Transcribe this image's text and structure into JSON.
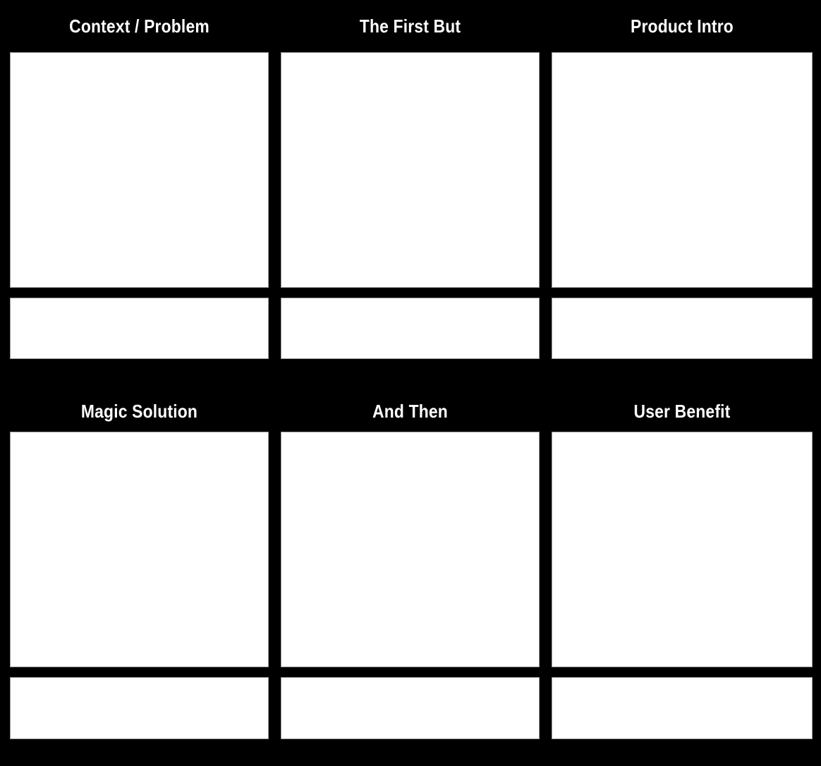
{
  "board": {
    "background_color": "#000000",
    "panel_fill_color": "#ffffff",
    "panel_border_color": "#9a9a9a",
    "title_color": "#ffffff",
    "rows": [
      {
        "panels": [
          {
            "title": "Context / Problem",
            "image_caption": "",
            "caption": ""
          },
          {
            "title": "The First But",
            "image_caption": "",
            "caption": ""
          },
          {
            "title": "Product Intro",
            "image_caption": "",
            "caption": ""
          }
        ]
      },
      {
        "panels": [
          {
            "title": "Magic Solution",
            "image_caption": "",
            "caption": ""
          },
          {
            "title": "And Then",
            "image_caption": "",
            "caption": ""
          },
          {
            "title": "User Benefit",
            "image_caption": "",
            "caption": ""
          }
        ]
      }
    ]
  }
}
